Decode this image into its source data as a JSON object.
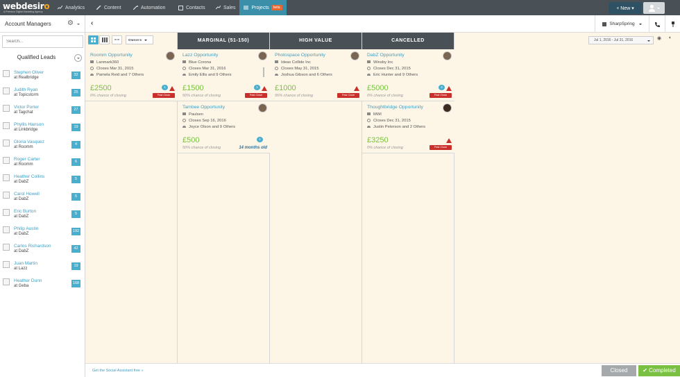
{
  "topbar": {
    "logo": "webdesir",
    "logo_tagline": "A Premium Digital Marketing Agency",
    "nav": [
      {
        "label": "Analytics",
        "icon": "chart-icon"
      },
      {
        "label": "Content",
        "icon": "pencil-icon"
      },
      {
        "label": "Automation",
        "icon": "wand-icon"
      },
      {
        "label": "Contacts",
        "icon": "contacts-icon"
      },
      {
        "label": "Sales",
        "icon": "trend-icon"
      },
      {
        "label": "Projects",
        "icon": "list-icon",
        "badge": "beta",
        "active": true
      }
    ],
    "new_label": "+ New ▾"
  },
  "sidebar": {
    "title": "Account Managers",
    "search_placeholder": "Search...",
    "qualified_title": "Qualified Leads",
    "leads": [
      {
        "name": "Stephen Oliver",
        "company": "at Realbridge",
        "count": "32"
      },
      {
        "name": "Judith Ryan",
        "company": "at Topicstorm",
        "count": "25"
      },
      {
        "name": "Victor Porter",
        "company": "at Tagchat",
        "count": "27"
      },
      {
        "name": "Phyllis Hanson",
        "company": "at Linkbridge",
        "count": "19"
      },
      {
        "name": "Gloria Vasquez",
        "company": "at Roomm",
        "count": "4"
      },
      {
        "name": "Roger Carter",
        "company": "at Roomm",
        "count": "6"
      },
      {
        "name": "Heather Collins",
        "company": "at DabZ",
        "count": "5"
      },
      {
        "name": "Carol Howell",
        "company": "at DabZ",
        "count": "5"
      },
      {
        "name": "Eric Burton",
        "company": "at DabZ",
        "count": "5"
      },
      {
        "name": "Philip Austin",
        "company": "at DabZ",
        "count": "192"
      },
      {
        "name": "Carlos Richardson",
        "company": "at DabZ",
        "count": "42"
      },
      {
        "name": "Juan Martin",
        "company": "at Lazz",
        "count": "19"
      },
      {
        "name": "Heather Dunn",
        "company": "at Geba",
        "count": "168"
      }
    ]
  },
  "toolbar": {
    "owners_label": "Owners",
    "sharpspring_label": "SharpSpring",
    "date_range": "Jul 1, 2016 - Jul 31, 2016"
  },
  "columns": [
    {
      "title": "",
      "cards": [
        {
          "title": "Roomm Opportunity",
          "company": "Lanmark360",
          "closes": "Closes Mar 31, 2015",
          "people": "Pamela Reid and 7 Others",
          "amount": "£2500",
          "chance": "0% chance of closing",
          "badge": "1",
          "past_close": "Past Close"
        }
      ]
    },
    {
      "title": "MARGINAL (51-150)",
      "cards": [
        {
          "title": "Lazz Opportunity",
          "company": "Blue Corona",
          "closes": "Closes Mar 31, 2016",
          "people": "Emily Ellis and 9 Others",
          "amount": "£1500",
          "chance": "50% chance of closing",
          "badge": "1",
          "past_close": "Past Close"
        },
        {
          "title": "Tambee Opportunity",
          "company": "Paulsen",
          "closes": "Closes Sep 16, 2016",
          "people": "Joyce Olson and 9 Others",
          "amount": "£500",
          "chance": "50% chance of closing",
          "badge": "1",
          "age": "14 months old"
        }
      ]
    },
    {
      "title": "HIGH VALUE",
      "cards": [
        {
          "title": "Photospace Opportunity",
          "company": "Ideas Collide Inc",
          "closes": "Closes May 31, 2015",
          "people": "Joshua Gibson and 6 Others",
          "amount": "£1000",
          "chance": "95% chance of closing",
          "past_close": "Past Close"
        }
      ]
    },
    {
      "title": "CANCELLED",
      "cards": [
        {
          "title": "DabZ Opportunity",
          "company": "Winsby Inc",
          "closes": "Closes Dec 31, 2015",
          "people": "Eric Hunter and 9 Others",
          "amount": "£5000",
          "chance": "0% chance of closing",
          "badge": "4",
          "past_close": "Past Close"
        },
        {
          "title": "Thoughtbridge Opportunity",
          "company": "MWI",
          "closes": "Closes Dec 31, 2015",
          "people": "Justin Peterson and 2 Others",
          "amount": "£3250",
          "chance": "0% chance of closing",
          "past_close": "Past Close"
        }
      ]
    }
  ],
  "footer": {
    "social_link": "Get the Social Assistant free »",
    "closed_label": "Closed",
    "completed_label": "✔ Completed"
  },
  "colors": {
    "topbar": "#4a5156",
    "accent": "#4aaecf",
    "amount": "#7ac143",
    "alert": "#c9302c",
    "board": "#fdf5e6"
  }
}
